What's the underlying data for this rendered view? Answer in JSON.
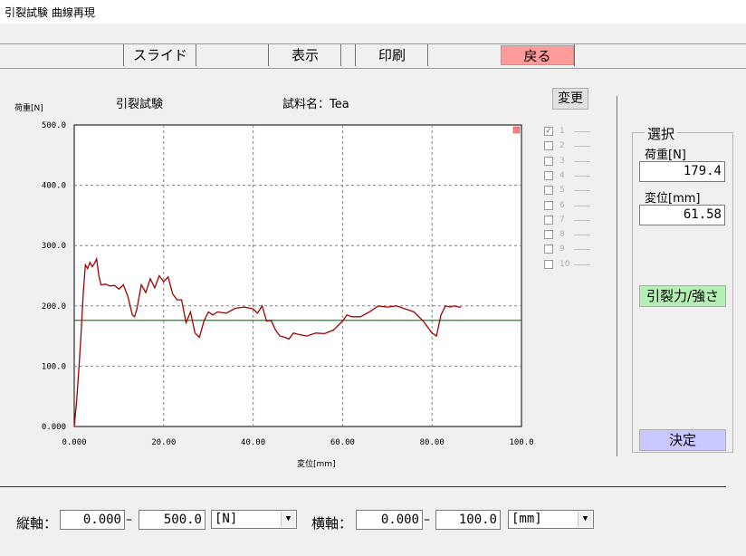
{
  "window": {
    "title": "引裂試験 曲線再現"
  },
  "toolbar": {
    "slide": "スライド",
    "display": "表示",
    "print": "印刷",
    "back": "戻る"
  },
  "chart_header": {
    "test_name": "引裂試験",
    "sample_name": "試料名：Tea",
    "change_button": "変更"
  },
  "chart_data": {
    "type": "line",
    "ylabel": "荷重[N]",
    "xlabel": "変位[mm]",
    "xlim": [
      0,
      100
    ],
    "ylim": [
      0,
      500
    ],
    "x_ticks": [
      "0.000",
      "20.00",
      "40.00",
      "60.00",
      "80.00",
      "100.0"
    ],
    "y_ticks": [
      "0.000",
      "100.0",
      "200.0",
      "300.0",
      "400.0",
      "500.0"
    ],
    "grid": true,
    "series_color": "#a00000",
    "reference_line": {
      "y": 176,
      "color": "#109010"
    },
    "x": [
      0,
      0.5,
      1,
      1.5,
      2,
      2.5,
      3,
      3.5,
      4,
      4.5,
      5,
      5.5,
      6,
      7,
      8,
      9,
      10,
      11,
      12,
      13,
      13.5,
      14,
      15,
      16,
      17,
      18,
      19,
      20,
      21,
      22,
      23,
      24,
      25,
      26,
      27,
      28,
      29,
      30,
      31,
      32,
      34,
      36,
      38,
      40,
      41,
      42,
      43,
      44,
      45,
      46,
      47,
      48,
      49,
      50,
      52,
      54,
      56,
      58,
      60,
      61,
      62,
      64,
      66,
      68,
      70,
      72,
      74,
      76,
      78,
      79,
      80,
      81,
      82,
      83,
      84,
      85,
      86,
      86.5
    ],
    "y": [
      0,
      40,
      90,
      150,
      220,
      268,
      262,
      272,
      265,
      270,
      278,
      250,
      235,
      236,
      233,
      234,
      228,
      235,
      215,
      185,
      182,
      195,
      235,
      222,
      245,
      230,
      250,
      240,
      248,
      220,
      210,
      210,
      172,
      190,
      155,
      148,
      175,
      190,
      185,
      190,
      188,
      196,
      198,
      195,
      188,
      200,
      175,
      176,
      160,
      150,
      148,
      145,
      155,
      153,
      150,
      155,
      154,
      160,
      175,
      185,
      182,
      182,
      190,
      200,
      198,
      200,
      195,
      190,
      175,
      165,
      155,
      150,
      185,
      200,
      198,
      200,
      198,
      198
    ],
    "legend": [
      "1",
      "2",
      "3",
      "4",
      "5",
      "6",
      "7",
      "8",
      "9",
      "10"
    ]
  },
  "selection": {
    "title": "選択",
    "load_label": "荷重[N]",
    "load_value": "179.4",
    "disp_label": "変位[mm]",
    "disp_value": "61.58",
    "tear_button": "引裂力/強さ",
    "confirm_button": "決定",
    "colors": {
      "tear": "#b4f0b4",
      "confirm": "#c8c8ff"
    }
  },
  "axis_controls": {
    "vertical_label": "縦軸：",
    "vertical_min": "0.000",
    "vertical_max": "500.0",
    "vertical_unit": "[N]",
    "horizontal_label": "横軸：",
    "horizontal_min": "0.000",
    "horizontal_max": "100.0",
    "horizontal_unit": "[mm]",
    "range_sep": "–"
  }
}
